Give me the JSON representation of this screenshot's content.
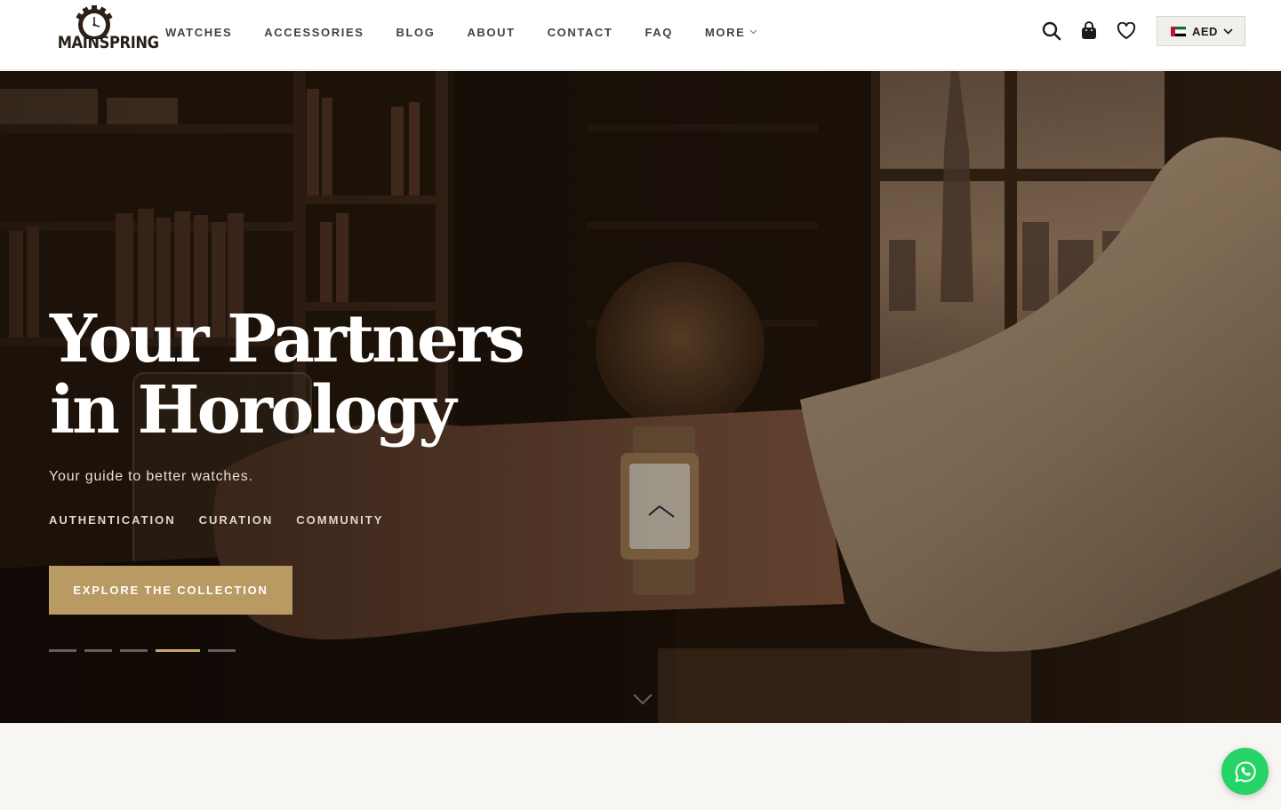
{
  "brand": {
    "name": "MAINSPRING"
  },
  "nav": {
    "items": [
      {
        "label": "WATCHES"
      },
      {
        "label": "ACCESSORIES"
      },
      {
        "label": "BLOG"
      },
      {
        "label": "ABOUT"
      },
      {
        "label": "CONTACT"
      },
      {
        "label": "FAQ"
      }
    ],
    "more_label": "MORE"
  },
  "header_icons": [
    "search-icon",
    "shopping-bag-icon",
    "heart-icon"
  ],
  "currency": {
    "code": "AED",
    "flag": "uae-flag-icon",
    "flag_colors": [
      "#c8102e",
      "#00732f",
      "#ffffff",
      "#000000"
    ]
  },
  "hero": {
    "title": "Your Partners in Horology",
    "subtitle": "Your guide to better watches.",
    "tags": [
      "AUTHENTICATION",
      "CURATION",
      "COMMUNITY"
    ],
    "cta_label": "EXPLORE THE COLLECTION",
    "slides_total": 5,
    "active_slide": 4
  },
  "colors": {
    "accent": "#b89a62",
    "whatsapp": "#25d366",
    "nav_text": "#4a4037"
  },
  "floating": {
    "whatsapp_icon": "whatsapp-icon"
  }
}
